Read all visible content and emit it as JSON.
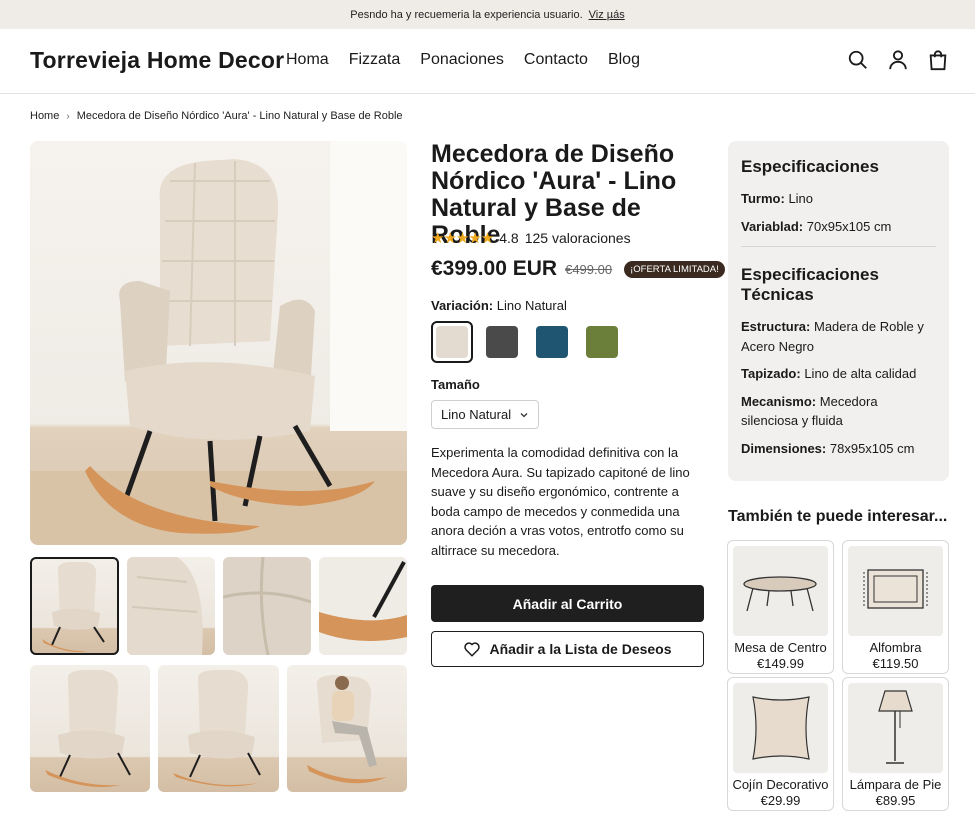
{
  "announcement": {
    "text": "Pesndo ha y recuemeria la experiencia usuario.",
    "link": "Viz µás"
  },
  "header": {
    "logo": "Torrevieja Home Decor",
    "nav": [
      "Homa",
      "Fizzata",
      "Ponaciones",
      "Contacto",
      "Blog"
    ],
    "icons": [
      "search-icon",
      "user-icon",
      "bag-icon"
    ]
  },
  "breadcrumb": {
    "home": "Home",
    "current": "Mecedora de Diseño Nórdico 'Aura' - Lino Natural y Base de Roble"
  },
  "product": {
    "title": "Mecedora de Diseño Nórdico 'Aura' - Lino Natural y Base de Roble",
    "stars": "★★★★★",
    "rating": "4.8",
    "reviews": "125 valoraciones",
    "price": "€399.00 EUR",
    "old_price": "€499.00",
    "badge": "¡OFERTA LIMITADA!",
    "variation_label": "Variación:",
    "variation_value": "Lino Natural",
    "swatches": [
      "#e4dbd0",
      "#4a4a4a",
      "#1f5570",
      "#6b7f3a"
    ],
    "size_label": "Tamaño",
    "size_value": "Lino Natural",
    "description": "Experimenta la comodidad definitiva con la Mecedora Aura. Su tapizado capitoné de lino suave y su diseño ergonómico, contrente a boda campo de mecedos y conmedida una anora deción a vras votos, entrotfo como su altirrace su mecedora.",
    "add_to_cart": "Añadir al Carrito",
    "add_to_wishlist": "Añadir a la Lista de Deseos"
  },
  "specs": {
    "title": "Especificaciones",
    "rows": [
      {
        "k": "Turmo:",
        "v": "Lino"
      },
      {
        "k": "Variablad:",
        "v": "70x95x105 cm"
      }
    ],
    "tech_title": "Especificaciones Técnicas",
    "tech_rows": [
      {
        "k": "Estructura:",
        "v": "Madera de Roble y Acero Negro"
      },
      {
        "k": "Tapizado:",
        "v": "Lino de alta calidad"
      },
      {
        "k": "Mecanismo:",
        "v": "Mecedora silenciosa y fluida"
      },
      {
        "k": "Dimensiones:",
        "v": "78x95x105 cm"
      }
    ]
  },
  "related": {
    "title": "También te puede interesar...",
    "items": [
      {
        "name": "Mesa de Centro",
        "price": "€149.99"
      },
      {
        "name": "Alfombra",
        "price": "€119.50"
      },
      {
        "name": "Cojín Decorativo",
        "price": "€29.99"
      },
      {
        "name": "Lámpara de Pie",
        "price": "€89.95"
      }
    ]
  }
}
